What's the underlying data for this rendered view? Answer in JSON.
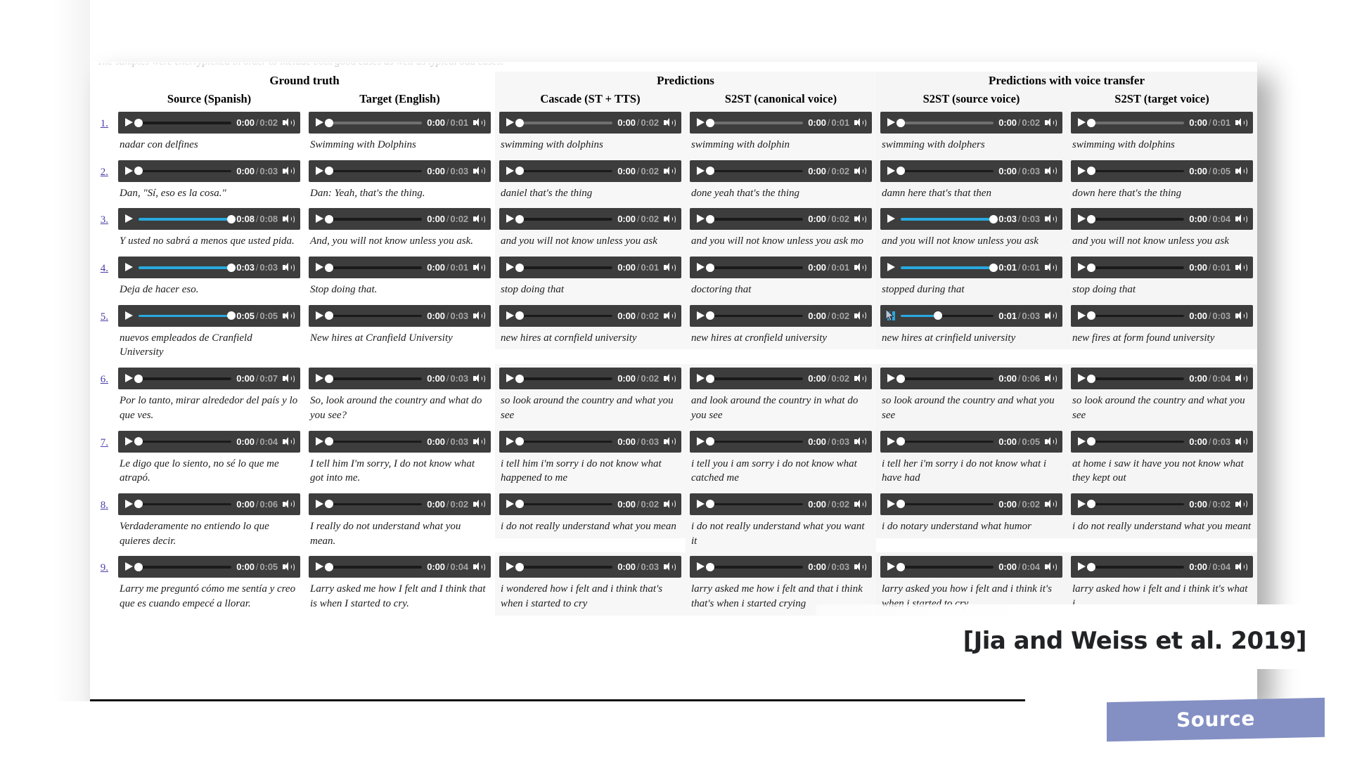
{
  "slide": {
    "cutoff_text": "The samples were cherrypicked in order to include both good cases as well as typical bad cases.",
    "citation": "[Jia and Weiss et al. 2019]",
    "source_button_label": "Source",
    "accent_played": "#29a9e0",
    "accent_button": "#8490c4",
    "player_bg": "#3d3d3d"
  },
  "table": {
    "groups": [
      {
        "label": "Ground truth",
        "span": 2,
        "tinted": false
      },
      {
        "label": "Predictions",
        "span": 2,
        "tinted": true
      },
      {
        "label": "Predictions with voice transfer",
        "span": 2,
        "tinted": true
      }
    ],
    "columns": [
      "Source (Spanish)",
      "Target (English)",
      "Cascade (ST + TTS)",
      "S2ST (canonical voice)",
      "S2ST (source voice)",
      "S2ST (target voice)"
    ],
    "rows": [
      {
        "index": "1.",
        "cells": [
          {
            "current": "0:00",
            "duration": "0:02",
            "played_pct": 0,
            "buffered_pct": 100,
            "state": "paused",
            "caption": "nadar con delfines"
          },
          {
            "current": "0:00",
            "duration": "0:01",
            "played_pct": 0,
            "buffered_pct": 0,
            "state": "paused",
            "caption": "Swimming with Dolphins"
          },
          {
            "current": "0:00",
            "duration": "0:02",
            "played_pct": 0,
            "buffered_pct": 0,
            "state": "paused",
            "caption": "swimming with dolphins"
          },
          {
            "current": "0:00",
            "duration": "0:01",
            "played_pct": 0,
            "buffered_pct": 0,
            "state": "paused",
            "caption": "swimming with dolphin"
          },
          {
            "current": "0:00",
            "duration": "0:02",
            "played_pct": 0,
            "buffered_pct": 0,
            "state": "paused",
            "caption": "swimming with dolphers"
          },
          {
            "current": "0:00",
            "duration": "0:01",
            "played_pct": 0,
            "buffered_pct": 0,
            "state": "paused",
            "caption": "swimming with dolphins"
          }
        ]
      },
      {
        "index": "2.",
        "cells": [
          {
            "current": "0:00",
            "duration": "0:03",
            "played_pct": 0,
            "buffered_pct": 100,
            "state": "paused",
            "caption": "Dan, \"Sí, eso es la cosa.\""
          },
          {
            "current": "0:00",
            "duration": "0:03",
            "played_pct": 0,
            "buffered_pct": 100,
            "state": "paused",
            "caption": "Dan: Yeah, that's the thing."
          },
          {
            "current": "0:00",
            "duration": "0:02",
            "played_pct": 0,
            "buffered_pct": 100,
            "state": "paused",
            "caption": "daniel that's the thing"
          },
          {
            "current": "0:00",
            "duration": "0:02",
            "played_pct": 0,
            "buffered_pct": 100,
            "state": "paused",
            "caption": "done yeah that's the thing"
          },
          {
            "current": "0:00",
            "duration": "0:03",
            "played_pct": 0,
            "buffered_pct": 100,
            "state": "paused",
            "caption": "damn here that's that then"
          },
          {
            "current": "0:00",
            "duration": "0:05",
            "played_pct": 0,
            "buffered_pct": 100,
            "state": "paused",
            "caption": "down here that's the thing"
          }
        ]
      },
      {
        "index": "3.",
        "cells": [
          {
            "current": "0:08",
            "duration": "0:08",
            "played_pct": 100,
            "buffered_pct": 100,
            "state": "paused",
            "caption": "Y usted no sabrá a menos que usted pida."
          },
          {
            "current": "0:00",
            "duration": "0:02",
            "played_pct": 0,
            "buffered_pct": 100,
            "state": "paused",
            "caption": "And, you will not know unless you ask."
          },
          {
            "current": "0:00",
            "duration": "0:02",
            "played_pct": 0,
            "buffered_pct": 100,
            "state": "paused",
            "caption": "and you will not know unless you ask"
          },
          {
            "current": "0:00",
            "duration": "0:02",
            "played_pct": 0,
            "buffered_pct": 100,
            "state": "paused",
            "caption": "and you will not know unless you ask mo"
          },
          {
            "current": "0:03",
            "duration": "0:03",
            "played_pct": 100,
            "buffered_pct": 100,
            "state": "paused",
            "caption": "and you will not know unless you ask"
          },
          {
            "current": "0:00",
            "duration": "0:04",
            "played_pct": 0,
            "buffered_pct": 100,
            "state": "paused",
            "caption": "and you will not know unless you ask"
          }
        ]
      },
      {
        "index": "4.",
        "cells": [
          {
            "current": "0:03",
            "duration": "0:03",
            "played_pct": 100,
            "buffered_pct": 100,
            "state": "paused",
            "caption": "Deja de hacer eso."
          },
          {
            "current": "0:00",
            "duration": "0:01",
            "played_pct": 0,
            "buffered_pct": 100,
            "state": "paused",
            "caption": "Stop doing that."
          },
          {
            "current": "0:00",
            "duration": "0:01",
            "played_pct": 0,
            "buffered_pct": 100,
            "state": "paused",
            "caption": "stop doing that"
          },
          {
            "current": "0:00",
            "duration": "0:01",
            "played_pct": 0,
            "buffered_pct": 100,
            "state": "paused",
            "caption": "doctoring that"
          },
          {
            "current": "0:01",
            "duration": "0:01",
            "played_pct": 100,
            "buffered_pct": 100,
            "state": "paused",
            "caption": "stopped during that"
          },
          {
            "current": "0:00",
            "duration": "0:01",
            "played_pct": 0,
            "buffered_pct": 100,
            "state": "paused",
            "caption": "stop doing that"
          }
        ]
      },
      {
        "index": "5.",
        "cells": [
          {
            "current": "0:05",
            "duration": "0:05",
            "played_pct": 100,
            "buffered_pct": 100,
            "state": "paused",
            "caption": "nuevos empleados de Cranfield University"
          },
          {
            "current": "0:00",
            "duration": "0:03",
            "played_pct": 0,
            "buffered_pct": 100,
            "state": "paused",
            "caption": "New hires at Cranfield University"
          },
          {
            "current": "0:00",
            "duration": "0:02",
            "played_pct": 0,
            "buffered_pct": 100,
            "state": "paused",
            "caption": "new hires at cornfield university"
          },
          {
            "current": "0:00",
            "duration": "0:02",
            "played_pct": 0,
            "buffered_pct": 100,
            "state": "paused",
            "caption": "new hires at cronfield university"
          },
          {
            "current": "0:01",
            "duration": "0:03",
            "played_pct": 40,
            "buffered_pct": 100,
            "state": "playing",
            "caption": "new hires at crinfield university"
          },
          {
            "current": "0:00",
            "duration": "0:03",
            "played_pct": 0,
            "buffered_pct": 100,
            "state": "paused",
            "caption": "new fires at form found university"
          }
        ]
      },
      {
        "index": "6.",
        "cells": [
          {
            "current": "0:00",
            "duration": "0:07",
            "played_pct": 0,
            "buffered_pct": 100,
            "state": "paused",
            "caption": "Por lo tanto, mirar alrededor del país y lo que ves."
          },
          {
            "current": "0:00",
            "duration": "0:03",
            "played_pct": 0,
            "buffered_pct": 100,
            "state": "paused",
            "caption": "So, look around the country and what do you see?"
          },
          {
            "current": "0:00",
            "duration": "0:02",
            "played_pct": 0,
            "buffered_pct": 100,
            "state": "paused",
            "caption": "so look around the country and what you see"
          },
          {
            "current": "0:00",
            "duration": "0:02",
            "played_pct": 0,
            "buffered_pct": 100,
            "state": "paused",
            "caption": "and look around the country in what do you see"
          },
          {
            "current": "0:00",
            "duration": "0:06",
            "played_pct": 0,
            "buffered_pct": 100,
            "state": "paused",
            "caption": "so look around the country and what you see"
          },
          {
            "current": "0:00",
            "duration": "0:04",
            "played_pct": 0,
            "buffered_pct": 100,
            "state": "paused",
            "caption": "so look around the country and what you see"
          }
        ]
      },
      {
        "index": "7.",
        "cells": [
          {
            "current": "0:00",
            "duration": "0:04",
            "played_pct": 0,
            "buffered_pct": 100,
            "state": "paused",
            "caption": "Le digo que lo siento, no sé lo que me atrapó."
          },
          {
            "current": "0:00",
            "duration": "0:03",
            "played_pct": 0,
            "buffered_pct": 100,
            "state": "paused",
            "caption": "I tell him I'm sorry, I do not know what got into me."
          },
          {
            "current": "0:00",
            "duration": "0:03",
            "played_pct": 0,
            "buffered_pct": 100,
            "state": "paused",
            "caption": "i tell him i'm sorry i do not know what happened to me"
          },
          {
            "current": "0:00",
            "duration": "0:03",
            "played_pct": 0,
            "buffered_pct": 100,
            "state": "paused",
            "caption": "i tell you i am sorry i do not know what catched me"
          },
          {
            "current": "0:00",
            "duration": "0:05",
            "played_pct": 0,
            "buffered_pct": 100,
            "state": "paused",
            "caption": "i tell her i'm sorry i do not know what i have had"
          },
          {
            "current": "0:00",
            "duration": "0:03",
            "played_pct": 0,
            "buffered_pct": 100,
            "state": "paused",
            "caption": "at home i saw it have you not know what they kept out"
          }
        ]
      },
      {
        "index": "8.",
        "cells": [
          {
            "current": "0:00",
            "duration": "0:06",
            "played_pct": 0,
            "buffered_pct": 100,
            "state": "paused",
            "caption": "Verdaderamente no entiendo lo que quieres decir."
          },
          {
            "current": "0:00",
            "duration": "0:02",
            "played_pct": 0,
            "buffered_pct": 100,
            "state": "paused",
            "caption": "I really do not understand what you mean."
          },
          {
            "current": "0:00",
            "duration": "0:02",
            "played_pct": 0,
            "buffered_pct": 100,
            "state": "paused",
            "caption": "i do not really understand what you mean"
          },
          {
            "current": "0:00",
            "duration": "0:02",
            "played_pct": 0,
            "buffered_pct": 100,
            "state": "paused",
            "caption": "i do not really understand what you want it"
          },
          {
            "current": "0:00",
            "duration": "0:02",
            "played_pct": 0,
            "buffered_pct": 100,
            "state": "paused",
            "caption": "i do notary understand what humor"
          },
          {
            "current": "0:00",
            "duration": "0:02",
            "played_pct": 0,
            "buffered_pct": 100,
            "state": "paused",
            "caption": "i do not really understand what you meant"
          }
        ]
      },
      {
        "index": "9.",
        "cells": [
          {
            "current": "0:00",
            "duration": "0:05",
            "played_pct": 0,
            "buffered_pct": 100,
            "state": "paused",
            "caption": "Larry me preguntó cómo me sentía y creo que es cuando empecé a llorar."
          },
          {
            "current": "0:00",
            "duration": "0:04",
            "played_pct": 0,
            "buffered_pct": 100,
            "state": "paused",
            "caption": "Larry asked me how I felt and I think that is when I started to cry."
          },
          {
            "current": "0:00",
            "duration": "0:03",
            "played_pct": 0,
            "buffered_pct": 100,
            "state": "paused",
            "caption": "i wondered how i felt and i think that's when i started to cry"
          },
          {
            "current": "0:00",
            "duration": "0:03",
            "played_pct": 0,
            "buffered_pct": 100,
            "state": "paused",
            "caption": "larry asked me how i felt and that i think that's when i started crying"
          },
          {
            "current": "0:00",
            "duration": "0:04",
            "played_pct": 0,
            "buffered_pct": 100,
            "state": "paused",
            "caption": "larry asked you how i felt and i think it's when i started to cry"
          },
          {
            "current": "0:00",
            "duration": "0:04",
            "played_pct": 0,
            "buffered_pct": 100,
            "state": "paused",
            "caption": "larry asked how i felt and i think it's what i"
          }
        ]
      }
    ]
  }
}
